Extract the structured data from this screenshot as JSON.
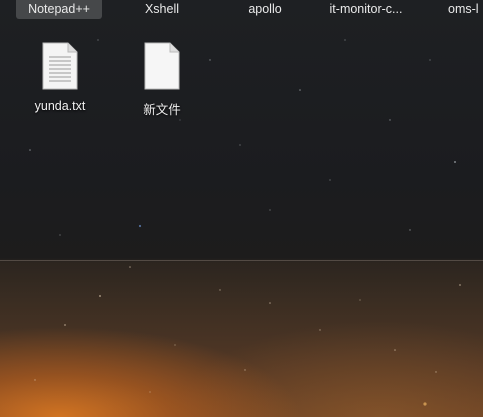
{
  "taskbar": {
    "items": [
      {
        "label": "Notepad++"
      },
      {
        "label": "Xshell"
      },
      {
        "label": "apollo"
      },
      {
        "label": "it-monitor-c..."
      },
      {
        "label": "oms-l"
      }
    ]
  },
  "desktop": {
    "icons": [
      {
        "label": "yunda.txt",
        "icon": "text-file-icon"
      },
      {
        "label": "新文件",
        "icon": "blank-file-icon"
      }
    ]
  },
  "colors": {
    "sky": "#1d1e21",
    "horizon_glow": "#d67622",
    "label_text": "#f2f2f2"
  }
}
